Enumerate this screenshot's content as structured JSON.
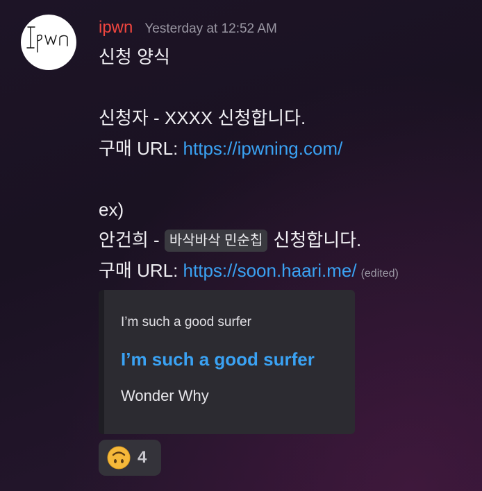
{
  "message": {
    "author": "ipwn",
    "timestamp": "Yesterday at 12:52 AM",
    "avatar_text": "Ipwn",
    "lines": {
      "l1": "신청 양식",
      "l3": "신청자 - XXXX 신청합니다.",
      "l4_label": "구매 URL: ",
      "l4_link": "https://ipwning.com/",
      "l6": "ex)",
      "l7_prefix": "안건희 - ",
      "l7_code": "바삭바삭 민순칩",
      "l7_suffix": " 신청합니다.",
      "l8_label": "구매 URL: ",
      "l8_link": "https://soon.haari.me/",
      "edited": "(edited)"
    },
    "embed": {
      "provider": "I’m such a good surfer",
      "title": "I’m such a good surfer",
      "description": "Wonder Why",
      "title_color": "#3aa2f3"
    },
    "reaction": {
      "emoji": "upside-down-face-icon",
      "count": "4"
    },
    "colors": {
      "author": "#f0463f",
      "link": "#3aa2f3",
      "timestamp": "#9a97a3"
    }
  }
}
